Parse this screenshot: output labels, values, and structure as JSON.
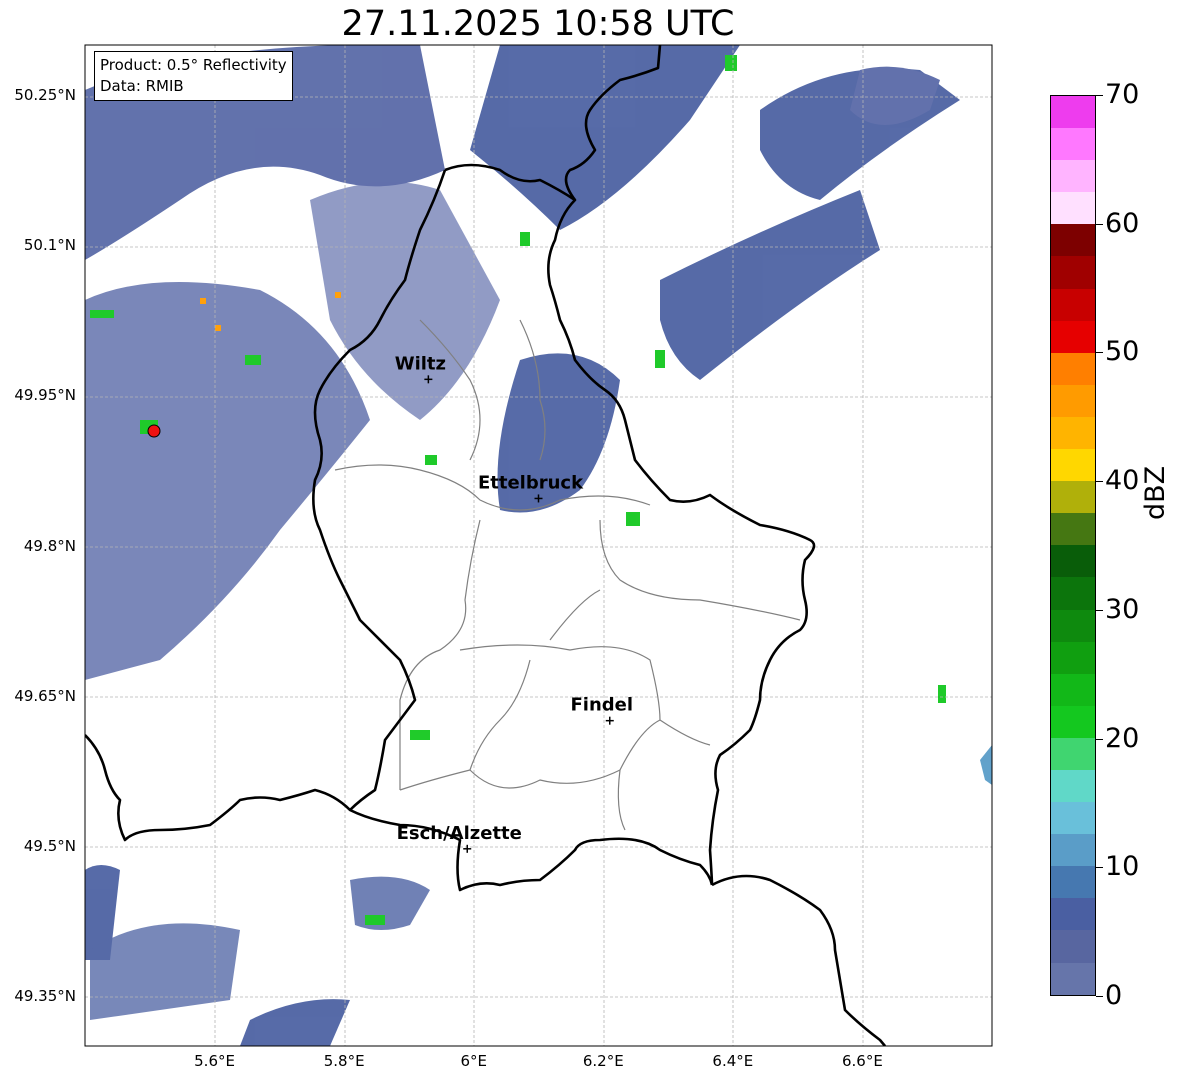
{
  "title": "27.11.2025 10:58 UTC",
  "info": {
    "product": "Product: 0.5° Reflectivity",
    "data": "Data: RMIB"
  },
  "map": {
    "lon_range": [
      5.4,
      6.8
    ],
    "lat_range": [
      49.3,
      50.3
    ],
    "lat_ticks": [
      "50.25°N",
      "50.1°N",
      "49.95°N",
      "49.8°N",
      "49.65°N",
      "49.5°N",
      "49.35°N"
    ],
    "lon_ticks": [
      "5.6°E",
      "5.8°E",
      "6°E",
      "6.2°E",
      "6.4°E",
      "6.6°E"
    ],
    "grid": true,
    "radar_site_color": "#ee1111",
    "cities": [
      {
        "name": "Wiltz",
        "lon": 5.93,
        "lat": 49.966
      },
      {
        "name": "Ettelbruck",
        "lon": 6.1,
        "lat": 49.847
      },
      {
        "name": "Findel",
        "lon": 6.21,
        "lat": 49.625
      },
      {
        "name": "Esch/Alzette",
        "lon": 5.99,
        "lat": 49.497
      }
    ]
  },
  "colorbar": {
    "label": "dBZ",
    "ticks": [
      "0",
      "10",
      "20",
      "30",
      "40",
      "50",
      "60",
      "70"
    ],
    "colors": [
      "#6675aa",
      "#5866a0",
      "#4a5fa2",
      "#4678b0",
      "#5a9dc8",
      "#69c0da",
      "#60d8c8",
      "#40d570",
      "#14c81f",
      "#12b818",
      "#109f10",
      "#0e8a0e",
      "#0c750c",
      "#095d09",
      "#457712",
      "#b0b00a",
      "#ffd700",
      "#ffb400",
      "#ff9b00",
      "#ff7f00",
      "#e60000",
      "#c80000",
      "#a00000",
      "#7d0000",
      "#ffe0ff",
      "#ffb4ff",
      "#ff78ff",
      "#ee3cee"
    ]
  }
}
